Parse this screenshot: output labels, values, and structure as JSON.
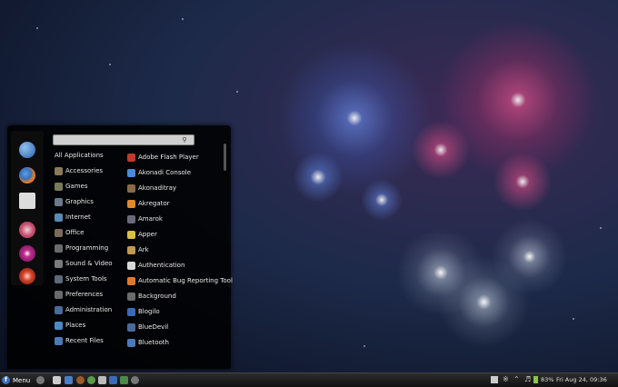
{
  "search": {
    "placeholder": ""
  },
  "categories": [
    "All Applications",
    "Accessories",
    "Games",
    "Graphics",
    "Internet",
    "Office",
    "Programming",
    "Sound & Video",
    "System Tools",
    "Preferences",
    "Administration",
    "Places",
    "Recent Files"
  ],
  "apps": [
    "Adobe Flash Player",
    "Akonadi Console",
    "Akonaditray",
    "Akregator",
    "Amarok",
    "Apper",
    "Ark",
    "Authentication",
    "Automatic Bug Reporting Tool",
    "Background",
    "Blogilo",
    "BlueDevil",
    "Bluetooth"
  ],
  "taskbar": {
    "menu_label": "Menu",
    "battery": "83%",
    "clock": "Fri Aug 24, 09:36"
  },
  "icons": {
    "favorites": [
      "globe-icon",
      "firefox-icon",
      "files-icon",
      "user-icon",
      "logout-icon",
      "power-icon"
    ],
    "category_icons": [
      "",
      "accessories-icon",
      "games-icon",
      "graphics-icon",
      "internet-icon",
      "office-icon",
      "programming-icon",
      "sound-video-icon",
      "system-tools-icon",
      "preferences-icon",
      "administration-icon",
      "places-icon",
      "recent-files-icon"
    ],
    "app_icons": [
      "flash-icon",
      "akonadi-icon",
      "akonaditray-icon",
      "akregator-icon",
      "amarok-icon",
      "apper-icon",
      "ark-icon",
      "authentication-icon",
      "bug-report-icon",
      "background-icon",
      "blogilo-icon",
      "bluedevil-icon",
      "bluetooth-icon"
    ]
  },
  "colors": {
    "flash": "#c0392b",
    "globe": "#3d7cc9",
    "firework_blue": "#5a8ff0",
    "firework_pink": "#e4457f",
    "firework_white": "#e8eef8"
  }
}
